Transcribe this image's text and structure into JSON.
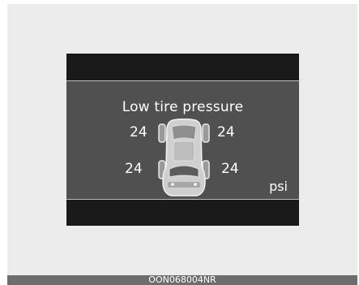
{
  "display": {
    "title": "Low tire pressure",
    "unit": "psi",
    "tires": {
      "front_left": "24",
      "front_right": "24",
      "rear_left": "24",
      "rear_right": "24"
    }
  },
  "footer": {
    "code": "OON068004NR"
  },
  "colors": {
    "background": "#ececec",
    "display_frame": "#1a1a1a",
    "display_panel": "#505050",
    "text": "#ffffff",
    "footer_bar": "#6d6d6d"
  },
  "icons": {
    "car": "car-top-view-icon"
  }
}
